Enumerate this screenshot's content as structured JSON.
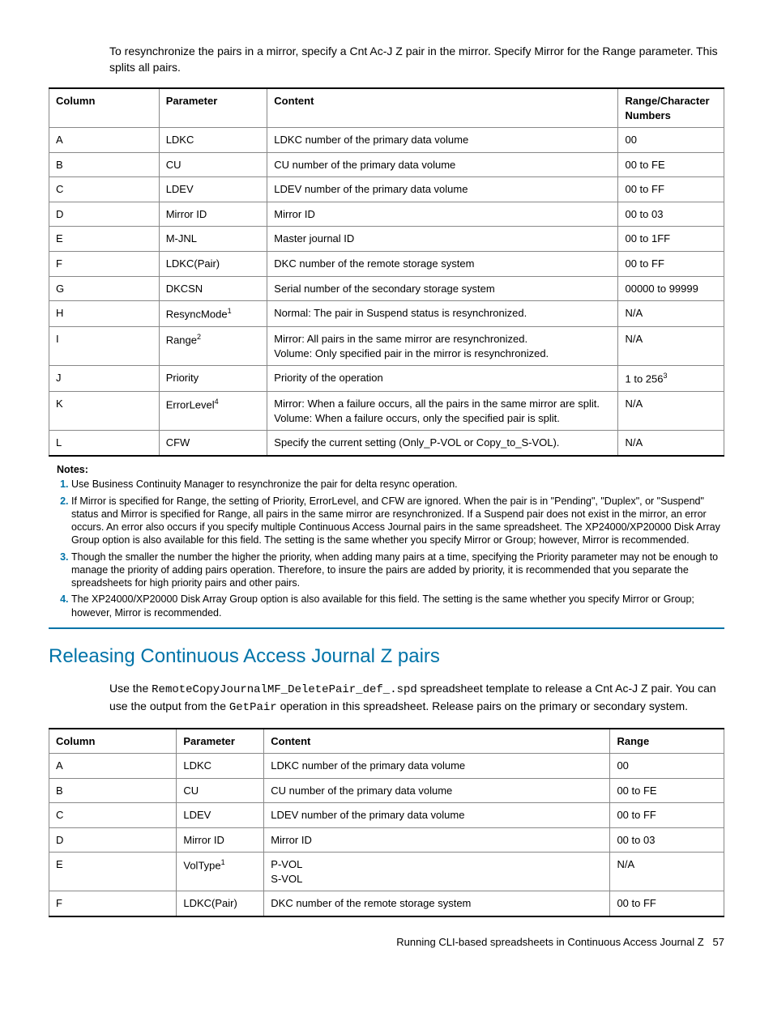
{
  "intro": "To resynchronize the pairs in a mirror, specify a Cnt Ac-J Z pair in the mirror. Specify Mirror for the Range parameter. This splits all pairs.",
  "table1": {
    "headers": {
      "c1": "Column",
      "c2": "Parameter",
      "c3": "Content",
      "c4": "Range/Character Numbers"
    },
    "rows": [
      {
        "col": "A",
        "param": "LDKC",
        "content": [
          "LDKC number of the primary data volume"
        ],
        "range": "00",
        "sup": ""
      },
      {
        "col": "B",
        "param": "CU",
        "content": [
          "CU number of the primary data volume"
        ],
        "range": "00 to FE",
        "sup": ""
      },
      {
        "col": "C",
        "param": "LDEV",
        "content": [
          "LDEV number of the primary data volume"
        ],
        "range": "00 to FF",
        "sup": ""
      },
      {
        "col": "D",
        "param": "Mirror ID",
        "content": [
          "Mirror ID"
        ],
        "range": "00 to 03",
        "sup": ""
      },
      {
        "col": "E",
        "param": "M-JNL",
        "content": [
          "Master journal ID"
        ],
        "range": "00 to 1FF",
        "sup": ""
      },
      {
        "col": "F",
        "param": "LDKC(Pair)",
        "content": [
          "DKC number of the remote storage system"
        ],
        "range": "00 to FF",
        "sup": ""
      },
      {
        "col": "G",
        "param": "DKCSN",
        "content": [
          "Serial number of the secondary storage system"
        ],
        "range": "00000 to 99999",
        "sup": ""
      },
      {
        "col": "H",
        "param": "ResyncMode",
        "content": [
          "Normal: The pair in Suspend status is resynchronized."
        ],
        "range": "N/A",
        "sup": "1"
      },
      {
        "col": "I",
        "param": "Range",
        "content": [
          "Mirror: All pairs in the same mirror are resynchronized.",
          "Volume: Only specified pair in the mirror is resynchronized."
        ],
        "range": "N/A",
        "sup": "2"
      },
      {
        "col": "J",
        "param": "Priority",
        "content": [
          "Priority of the operation"
        ],
        "range": "1 to 256",
        "range_sup": "3",
        "sup": ""
      },
      {
        "col": "K",
        "param": "ErrorLevel",
        "content": [
          "Mirror: When a failure occurs, all the pairs in the same mirror are split.",
          "Volume: When a failure occurs, only the specified pair is split."
        ],
        "range": "N/A",
        "sup": "4"
      },
      {
        "col": "L",
        "param": "CFW",
        "content": [
          "Specify the current setting (Only_P-VOL or Copy_to_S-VOL)."
        ],
        "range": "N/A",
        "sup": ""
      }
    ]
  },
  "notes_label": "Notes:",
  "notes": [
    "Use Business Continuity Manager to resynchronize the pair for delta resync operation.",
    "If Mirror is specified for Range, the setting of Priority, ErrorLevel, and CFW are ignored. When the pair is in \"Pending\", \"Duplex\", or \"Suspend\" status and Mirror is specified for Range, all pairs in the same mirror are resynchronized. If a Suspend pair does not exist in the mirror, an error occurs. An error also occurs if you specify multiple Continuous Access Journal pairs in the same spreadsheet. The XP24000/XP20000 Disk Array Group option is also available for this field. The setting is the same whether you specify Mirror or Group; however, Mirror is recommended.",
    "Though the smaller the number the higher the priority, when adding many pairs at a time, specifying the Priority parameter may not be enough to manage the priority of adding pairs operation. Therefore, to insure the pairs are added by priority, it is recommended that you separate the spreadsheets for high priority pairs and other pairs.",
    "The XP24000/XP20000 Disk Array Group option is also available for this field. The setting is the same whether you specify Mirror or Group; however, Mirror is recommended."
  ],
  "section_heading": "Releasing Continuous Access Journal Z pairs",
  "body": {
    "pre1": "Use the ",
    "code1": "RemoteCopyJournalMF_DeletePair_def_.spd",
    "mid1": " spreadsheet template to release a Cnt Ac-J Z pair. You can use the output from the ",
    "code2": "GetPair",
    "post1": " operation in this spreadsheet. Release pairs on the primary or secondary system."
  },
  "table2": {
    "headers": {
      "c1": "Column",
      "c2": "Parameter",
      "c3": "Content",
      "c4": "Range"
    },
    "rows": [
      {
        "col": "A",
        "param": "LDKC",
        "content": [
          "LDKC number of the primary data volume"
        ],
        "range": "00",
        "sup": ""
      },
      {
        "col": "B",
        "param": "CU",
        "content": [
          "CU number of the primary data volume"
        ],
        "range": "00 to FE",
        "sup": ""
      },
      {
        "col": "C",
        "param": "LDEV",
        "content": [
          "LDEV number of the primary data volume"
        ],
        "range": "00 to FF",
        "sup": ""
      },
      {
        "col": "D",
        "param": "Mirror ID",
        "content": [
          "Mirror ID"
        ],
        "range": "00 to 03",
        "sup": ""
      },
      {
        "col": "E",
        "param": "VolType",
        "content": [
          "P-VOL",
          "S-VOL"
        ],
        "range": "N/A",
        "sup": "1"
      },
      {
        "col": "F",
        "param": "LDKC(Pair)",
        "content": [
          "DKC number of the remote storage system"
        ],
        "range": "00 to FF",
        "sup": ""
      }
    ]
  },
  "footer": {
    "text": "Running CLI-based spreadsheets in Continuous Access Journal Z",
    "page": "57"
  }
}
